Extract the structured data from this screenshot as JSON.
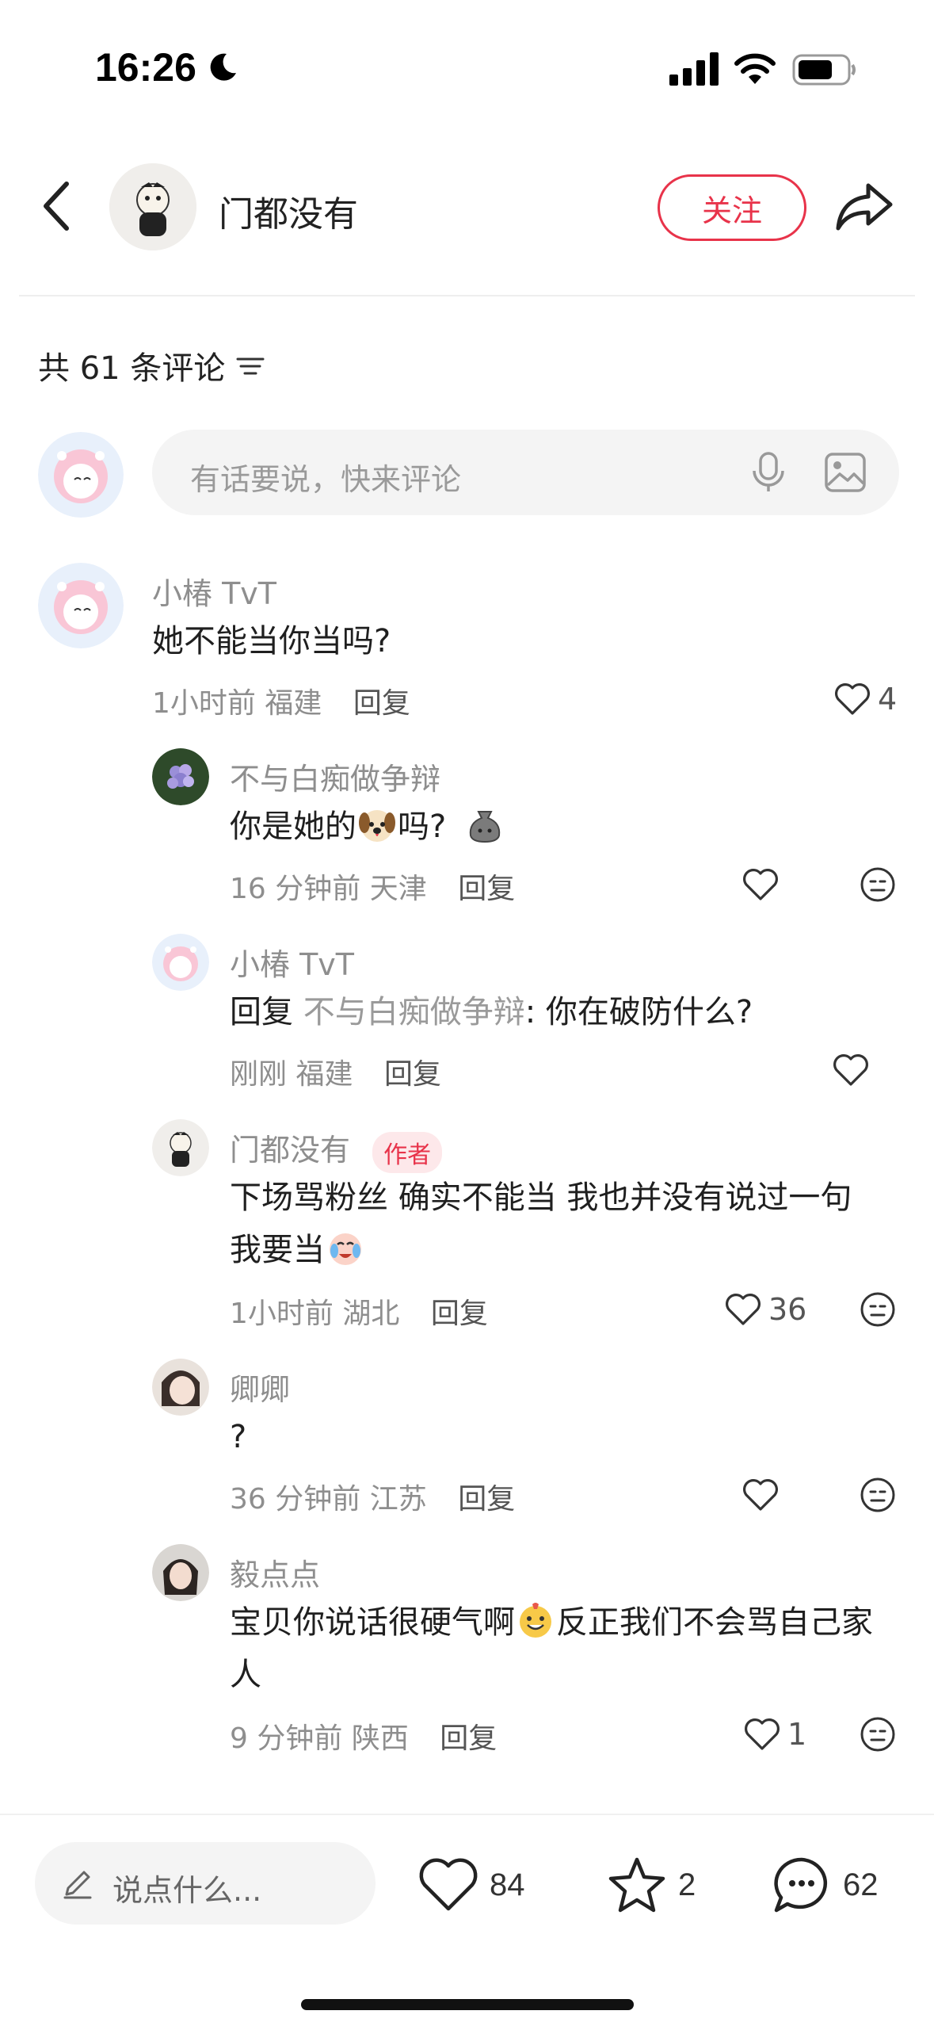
{
  "status_bar": {
    "time": "16:26"
  },
  "header": {
    "user_name": "门都没有",
    "follow_label": "关注"
  },
  "comments_section": {
    "count_label": "共 61 条评论",
    "input_placeholder": "有话要说，快来评论"
  },
  "comments": [
    {
      "name": "小椿 TvT",
      "text": "她不能当你当吗?",
      "time": "1小时前",
      "location": "福建",
      "reply_label": "回复",
      "likes": "4"
    },
    {
      "name": "不与白痴做争辩",
      "text_before": "你是她的",
      "text_after": "吗?",
      "time": "16 分钟前",
      "location": "天津",
      "reply_label": "回复"
    },
    {
      "name": "小椿 TvT",
      "reply_prefix": "回复",
      "reply_target": "不与白痴做争辩",
      "text": ": 你在破防什么?",
      "time": "刚刚",
      "location": "福建",
      "reply_label": "回复"
    },
    {
      "name": "门都没有",
      "badge": "作者",
      "line1": "下场骂粉丝 确实不能当 我也并没有说过一句",
      "line2": "我要当",
      "time": "1小时前",
      "location": "湖北",
      "reply_label": "回复",
      "likes": "36"
    },
    {
      "name": "卿卿",
      "text": "?",
      "time": "36 分钟前",
      "location": "江苏",
      "reply_label": "回复"
    },
    {
      "name": "毅点点",
      "line1_before": "宝贝你说话很硬气啊",
      "line1_after": "反正我们不会骂自己家",
      "line2": "人",
      "time": "9 分钟前",
      "location": "陕西",
      "reply_label": "回复",
      "likes": "1"
    }
  ],
  "bottom_bar": {
    "input_placeholder": "说点什么...",
    "likes": "84",
    "favorites": "2",
    "comments": "62"
  },
  "icons": [
    "moon-icon",
    "signal-icon",
    "wifi-icon",
    "battery-icon",
    "back-icon",
    "share-icon",
    "sort-icon",
    "mic-icon",
    "image-icon",
    "heart-icon",
    "dislike-icon",
    "pencil-icon",
    "star-icon",
    "comment-icon",
    "dog-emoji",
    "sack-emoji",
    "crying-emoji",
    "grin-emoji"
  ],
  "colors": {
    "accent": "#e8334a",
    "muted_text": "#8e8e8e",
    "input_bg": "#f4f4f4"
  }
}
